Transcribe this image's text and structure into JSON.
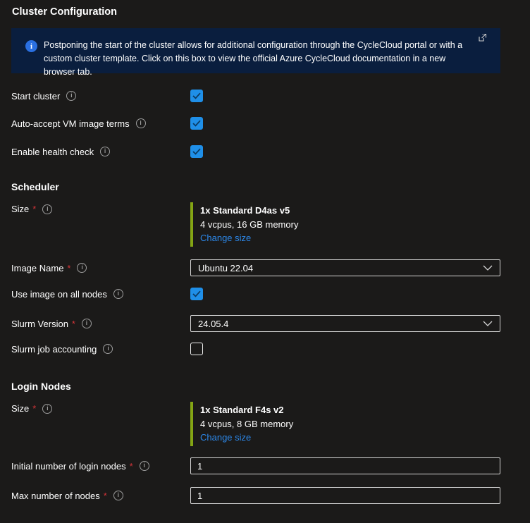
{
  "title": "Cluster Configuration",
  "ui": {
    "required_marker": "*",
    "info_glyph": "i"
  },
  "icons": {
    "info": "info-icon",
    "external_link": "external-link-icon",
    "chevron_down": "chevron-down-icon",
    "checkmark": "checkmark-icon"
  },
  "colors": {
    "page_background": "#1b1a19",
    "banner_background": "#0a1e3e",
    "banner_info_blue": "#2a6fe0",
    "checkbox_blue": "#1f8fe8",
    "link_blue": "#2c87e8",
    "size_indicator_green": "#84a514",
    "required_red": "#d13438",
    "field_border": "#d6d6d6"
  },
  "banner": {
    "message": "Postponing the start of the cluster allows for additional configuration through the CycleCloud portal or with a custom cluster template. Click on this box to view the official Azure CycleCloud documentation in a new browser tab."
  },
  "options": {
    "start_cluster": {
      "label": "Start cluster",
      "checked": true
    },
    "auto_accept": {
      "label": "Auto-accept VM image terms",
      "checked": true
    },
    "health_check": {
      "label": "Enable health check",
      "checked": true
    }
  },
  "scheduler": {
    "heading": "Scheduler",
    "size": {
      "label": "Size",
      "sku": "1x Standard D4as v5",
      "specs": "4 vcpus, 16 GB memory",
      "change_link": "Change size"
    },
    "image_name": {
      "label": "Image Name",
      "value": "Ubuntu 22.04"
    },
    "use_image_all_nodes": {
      "label": "Use image on all nodes",
      "checked": true
    },
    "slurm_version": {
      "label": "Slurm Version",
      "value": "24.05.4"
    },
    "slurm_job_accounting": {
      "label": "Slurm job accounting",
      "checked": false
    }
  },
  "login_nodes": {
    "heading": "Login Nodes",
    "size": {
      "label": "Size",
      "sku": "1x Standard F4s v2",
      "specs": "4 vcpus, 8 GB memory",
      "change_link": "Change size"
    },
    "initial_nodes": {
      "label": "Initial number of login nodes",
      "value": "1"
    },
    "max_nodes": {
      "label": "Max number of nodes",
      "value": "1"
    }
  }
}
